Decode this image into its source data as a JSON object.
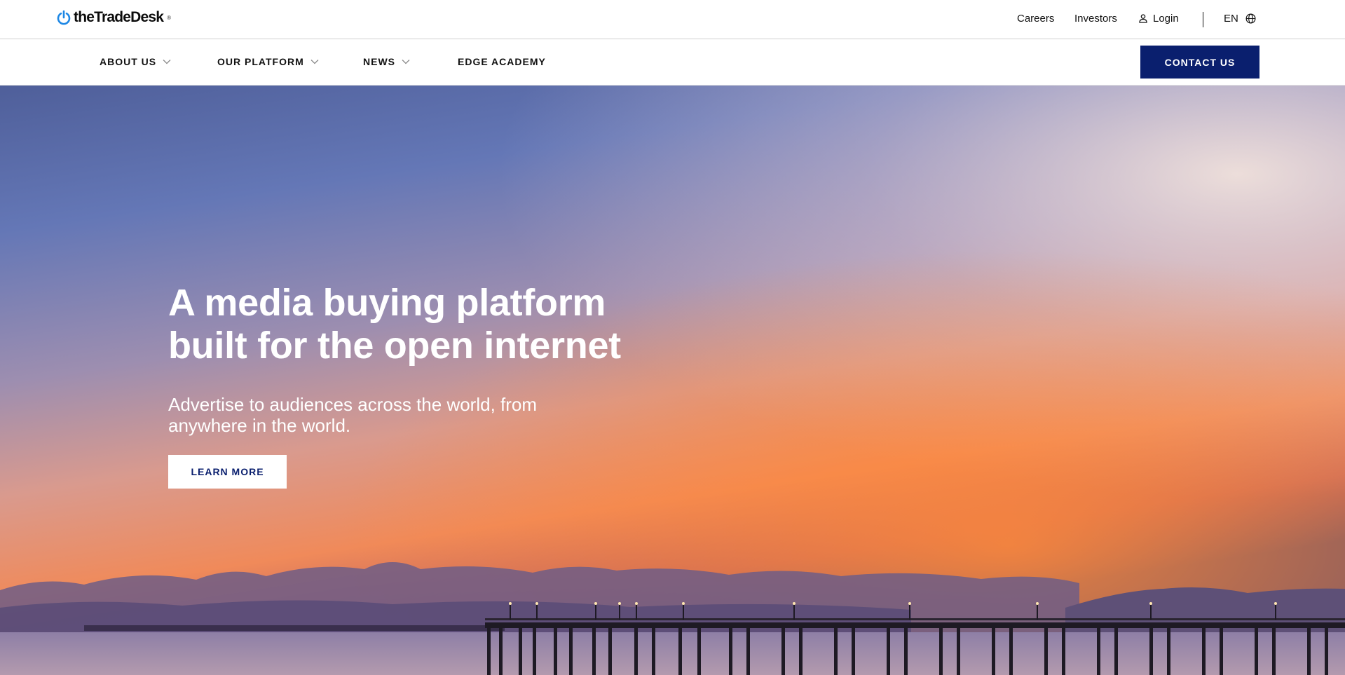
{
  "header": {
    "logo_text": "theTradeDesk",
    "logo_mark": "®",
    "utility": {
      "careers": "Careers",
      "investors": "Investors",
      "login": "Login",
      "language": "EN"
    }
  },
  "nav": {
    "items": [
      {
        "label": "ABOUT US",
        "has_dropdown": true
      },
      {
        "label": "OUR PLATFORM",
        "has_dropdown": true
      },
      {
        "label": "NEWS",
        "has_dropdown": true
      },
      {
        "label": "EDGE ACADEMY",
        "has_dropdown": false
      }
    ],
    "contact_label": "CONTACT US"
  },
  "hero": {
    "title_line1": "A media buying platform",
    "title_line2": "built for the open internet",
    "subtitle_line1": "Advertise to audiences across the world, from",
    "subtitle_line2": "anywhere in the world.",
    "cta_label": "LEARN MORE"
  },
  "colors": {
    "brand_navy": "#0a1f6e",
    "logo_blue": "#1e88e5",
    "text_dark": "#111111"
  },
  "icons": {
    "logo": "power-icon",
    "login": "user-icon",
    "language": "globe-icon",
    "dropdown": "chevron-down-icon"
  }
}
